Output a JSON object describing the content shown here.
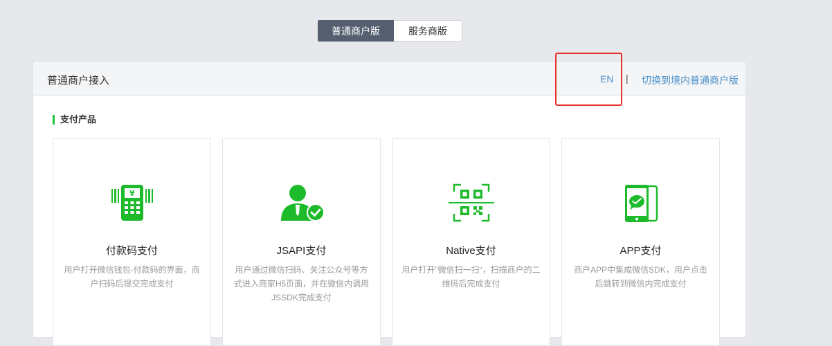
{
  "tabs": [
    {
      "label": "普通商户版",
      "active": true
    },
    {
      "label": "服务商版",
      "active": false
    }
  ],
  "header": {
    "title": "普通商户接入",
    "en_link": "EN",
    "separator": "|",
    "switch_link": "切换到境内普通商户版"
  },
  "section": {
    "title": "支付产品"
  },
  "products": [
    {
      "name": "付款码支付",
      "desc": "用户打开微信钱包-付款码的界面，商户扫码后提交完成支付",
      "icon": "payment-terminal-icon"
    },
    {
      "name": "JSAPI支付",
      "desc": "用户通过微信扫码、关注公众号等方式进入商家H5页面，并在微信内调用JSSDK完成支付",
      "icon": "user-check-icon"
    },
    {
      "name": "Native支付",
      "desc": "用户打开\"微信扫一扫“，扫描商户的二维码后完成支付",
      "icon": "qr-scan-icon"
    },
    {
      "name": "APP支付",
      "desc": "商户APP中集成微信SDK，用户点击后跳转到微信内完成支付",
      "icon": "phone-wechat-icon"
    }
  ],
  "colors": {
    "accent": "#22c03a",
    "link": "#4a90c8",
    "highlight": "#e8302c",
    "tab_active": "#555f70"
  }
}
